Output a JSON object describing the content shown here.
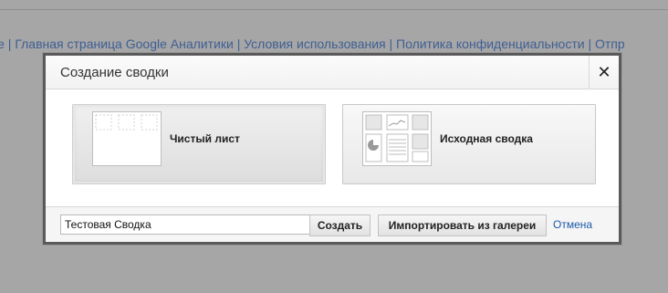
{
  "background": {
    "footer_links": [
      "le",
      "Главная страница Google Аналитики",
      "Условия использования",
      "Политика конфиденциальности",
      "Отпр"
    ],
    "separator": "|"
  },
  "modal": {
    "title": "Создание сводки",
    "close_icon": "close-icon",
    "close_glyph": "✕",
    "tiles": [
      {
        "label": "Чистый лист",
        "icon": "blank-canvas-icon",
        "selected": true
      },
      {
        "label": "Исходная сводка",
        "icon": "starter-dashboard-icon",
        "selected": false
      }
    ],
    "footer": {
      "name_value": "Тестовая Сводка",
      "create_label": "Создать",
      "import_label": "Импортировать из галереи",
      "cancel_label": "Отмена"
    }
  },
  "colors": {
    "overlay_bg": "#a6a6a6",
    "link_blue": "#1b5aa8",
    "modal_border": "#5a5a5a"
  }
}
